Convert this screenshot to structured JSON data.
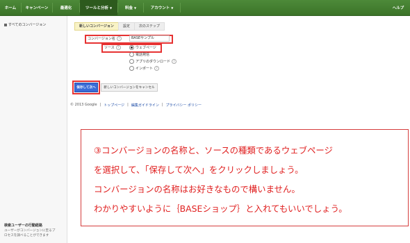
{
  "nav": {
    "home": "ホーム",
    "campaign": "キャンペーン",
    "optimize": "最適化",
    "tools": "ツールと分析",
    "billing": "料金",
    "account": "アカウント",
    "help": "ヘルプ"
  },
  "sidebar": {
    "all_conversions": "すべてのコンバージョン",
    "bottom_title": "検索ユーザーの行動経路",
    "bottom_text_1": "ユーザーがコンバージョンに至るプ",
    "bottom_text_2": "ロセスを調べることができます"
  },
  "steps": [
    "新しいコンバージョン",
    "設定",
    "次のステップ"
  ],
  "form": {
    "name_label": "コンバージョン名",
    "name_value": "BASEサンプル",
    "source_label": "ソース",
    "sources": [
      "ウェブページ",
      "電話発信",
      "アプリのダウンロード",
      "インポート"
    ],
    "selected_source": "ウェブページ"
  },
  "buttons": {
    "save": "保存して次へ",
    "cancel": "新しいコンバージョンをキャンセル"
  },
  "footer": {
    "copyright": "© 2013 Google",
    "links": [
      "トップページ",
      "編集ガイドライン",
      "プライバシー ポリシー"
    ]
  },
  "note": {
    "line1": "③コンバージョンの名称と、ソースの種類であるウェブページ",
    "line2": "を選択して、「保存して次へ」をクリックしましょう。",
    "line3": "コンバージョンの名称はお好きなもので構いません。",
    "line4": "わかりやすいように｛BASEショップ｝と入れてもいいでしょう。"
  },
  "colors": {
    "nav_green": "#3b7328",
    "annotation_red": "#e02020",
    "primary_button": "#3a6cd8"
  }
}
